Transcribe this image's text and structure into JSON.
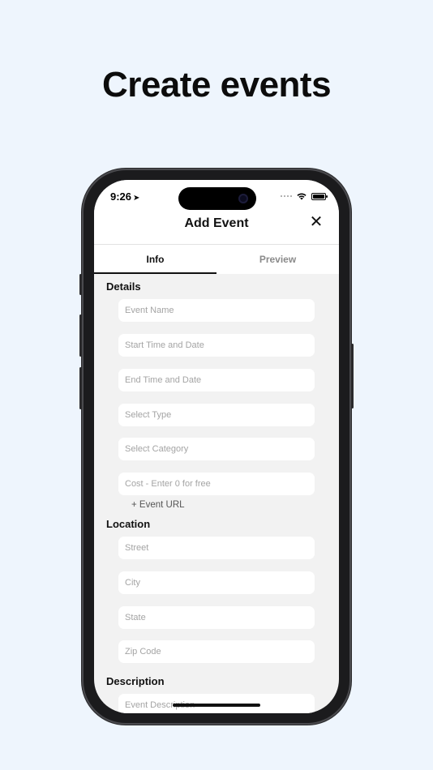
{
  "headline": "Create events",
  "status": {
    "time": "9:26",
    "location_icon": "location-arrow-icon"
  },
  "nav": {
    "title": "Add Event",
    "close_label": "✕"
  },
  "tabs": [
    {
      "label": "Info",
      "selected": true
    },
    {
      "label": "Preview",
      "selected": false
    }
  ],
  "details": {
    "title": "Details",
    "fields": [
      "Event Name",
      "Start Time and Date",
      "End Time and Date",
      "Select Type",
      "Select Category",
      "Cost - Enter 0 for free"
    ],
    "url_link": "+ Event URL"
  },
  "location": {
    "title": "Location",
    "fields": [
      "Street",
      "City",
      "State",
      "Zip Code"
    ]
  },
  "description": {
    "title": "Description",
    "placeholder": "Event Description"
  },
  "colors": {
    "background": "#eef5fd",
    "form_bg": "#f2f2f2",
    "field_bg": "#ffffff",
    "text": "#111111"
  }
}
